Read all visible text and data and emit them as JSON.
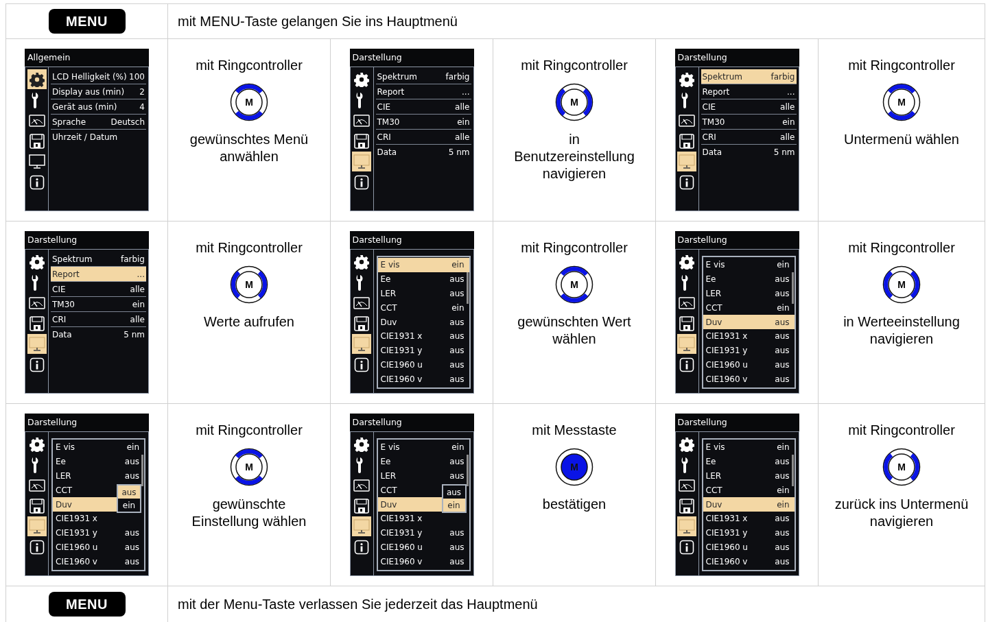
{
  "intro": {
    "key": "MENU",
    "text": "mit MENU-Taste gelangen Sie ins Hauptmenü"
  },
  "rows": [
    {
      "steps": [
        {
          "screen": {
            "title": "Allgemein",
            "icons": [
              {
                "kind": "gear",
                "selected": true
              },
              {
                "kind": "wrench",
                "selected": false
              },
              {
                "kind": "gauge",
                "selected": false
              },
              {
                "kind": "floppy",
                "selected": false
              },
              {
                "kind": "monitor",
                "selected": false
              },
              {
                "kind": "info",
                "selected": false
              }
            ],
            "items": [
              {
                "label": "LCD Helligkeit (%)",
                "value": "100",
                "selected": false
              },
              {
                "label": "Display aus (min)",
                "value": "2",
                "selected": false
              },
              {
                "label": "Gerät aus (min)",
                "value": "4",
                "selected": false
              },
              {
                "label": "Sprache",
                "value": "Deutsch",
                "selected": false
              },
              {
                "label": "Uhrzeit / Datum",
                "selected": false
              }
            ]
          },
          "control": {
            "kind": "vertical",
            "label": "M"
          },
          "heading": "mit Ringcontroller",
          "text": "gewünschtes Menü anwählen"
        },
        {
          "screen": {
            "title": "Darstellung",
            "icons": [
              {
                "kind": "gear",
                "selected": false
              },
              {
                "kind": "wrench",
                "selected": false
              },
              {
                "kind": "gauge",
                "selected": false
              },
              {
                "kind": "floppy",
                "selected": false
              },
              {
                "kind": "monitor",
                "selected": true
              },
              {
                "kind": "info",
                "selected": false
              }
            ],
            "items": [
              {
                "label": "Spektrum",
                "value": "farbig",
                "selected": false
              },
              {
                "label": "Report",
                "value": "...",
                "selected": false
              },
              {
                "label": "CIE",
                "value": "alle",
                "selected": false
              },
              {
                "label": "TM30",
                "value": "ein",
                "selected": false
              },
              {
                "label": "CRI",
                "value": "alle",
                "selected": false
              },
              {
                "label": "Data",
                "value": "5 nm",
                "selected": false
              }
            ]
          },
          "control": {
            "kind": "horizontal",
            "label": "M"
          },
          "heading": "mit Ringcontroller",
          "text": "in Benutzereinstellung navigieren"
        },
        {
          "screen": {
            "title": "Darstellung",
            "icons": [
              {
                "kind": "gear",
                "selected": false
              },
              {
                "kind": "wrench",
                "selected": false
              },
              {
                "kind": "gauge",
                "selected": false
              },
              {
                "kind": "floppy",
                "selected": false
              },
              {
                "kind": "monitor",
                "selected": true
              },
              {
                "kind": "info",
                "selected": false
              }
            ],
            "items": [
              {
                "label": "Spektrum",
                "value": "farbig",
                "selected": true
              },
              {
                "label": "Report",
                "value": "...",
                "selected": false
              },
              {
                "label": "CIE",
                "value": "alle",
                "selected": false
              },
              {
                "label": "TM30",
                "value": "ein",
                "selected": false
              },
              {
                "label": "CRI",
                "value": "alle",
                "selected": false
              },
              {
                "label": "Data",
                "value": "5 nm",
                "selected": false
              }
            ]
          },
          "control": {
            "kind": "vertical",
            "label": "M"
          },
          "heading": "mit Ringcontroller",
          "text": "Untermenü wählen"
        }
      ]
    },
    {
      "steps": [
        {
          "screen": {
            "title": "Darstellung",
            "icons": [
              {
                "kind": "gear",
                "selected": false
              },
              {
                "kind": "wrench",
                "selected": false
              },
              {
                "kind": "gauge",
                "selected": false
              },
              {
                "kind": "floppy",
                "selected": false
              },
              {
                "kind": "monitor",
                "selected": true
              },
              {
                "kind": "info",
                "selected": false
              }
            ],
            "items": [
              {
                "label": "Spektrum",
                "value": "farbig",
                "selected": false
              },
              {
                "label": "Report",
                "value": "...",
                "selected": true
              },
              {
                "label": "CIE",
                "value": "alle",
                "selected": false
              },
              {
                "label": "TM30",
                "value": "ein",
                "selected": false
              },
              {
                "label": "CRI",
                "value": "alle",
                "selected": false
              },
              {
                "label": "Data",
                "value": "5 nm",
                "selected": false
              }
            ]
          },
          "control": {
            "kind": "horizontal",
            "label": "M"
          },
          "heading": "mit Ringcontroller",
          "text": "Werte aufrufen"
        },
        {
          "screen": {
            "title": "Darstellung",
            "icons": [
              {
                "kind": "gear",
                "selected": false
              },
              {
                "kind": "wrench",
                "selected": false
              },
              {
                "kind": "gauge",
                "selected": false
              },
              {
                "kind": "floppy",
                "selected": false
              },
              {
                "kind": "monitor",
                "selected": true
              },
              {
                "kind": "info",
                "selected": false
              }
            ],
            "list": [
              {
                "label": "E vis",
                "value": "ein",
                "selected": true
              },
              {
                "label": "Ee",
                "value": "aus",
                "selected": false
              },
              {
                "label": "LER",
                "value": "aus",
                "selected": false
              },
              {
                "label": "CCT",
                "value": "ein",
                "selected": false
              },
              {
                "label": "Duv",
                "value": "aus",
                "selected": false
              },
              {
                "label": "CIE1931 x",
                "value": "aus",
                "selected": false
              },
              {
                "label": "CIE1931 y",
                "value": "aus",
                "selected": false
              },
              {
                "label": "CIE1960 u",
                "value": "aus",
                "selected": false
              },
              {
                "label": "CIE1960 v",
                "value": "aus",
                "selected": false
              }
            ]
          },
          "control": {
            "kind": "vertical",
            "label": "M"
          },
          "heading": "mit Ringcontroller",
          "text": "gewünschten Wert wählen"
        },
        {
          "screen": {
            "title": "Darstellung",
            "icons": [
              {
                "kind": "gear",
                "selected": false
              },
              {
                "kind": "wrench",
                "selected": false
              },
              {
                "kind": "gauge",
                "selected": false
              },
              {
                "kind": "floppy",
                "selected": false
              },
              {
                "kind": "monitor",
                "selected": true
              },
              {
                "kind": "info",
                "selected": false
              }
            ],
            "list": [
              {
                "label": "E vis",
                "value": "ein",
                "selected": false
              },
              {
                "label": "Ee",
                "value": "aus",
                "selected": false
              },
              {
                "label": "LER",
                "value": "aus",
                "selected": false
              },
              {
                "label": "CCT",
                "value": "ein",
                "selected": false
              },
              {
                "label": "Duv",
                "value": "aus",
                "selected": true
              },
              {
                "label": "CIE1931 x",
                "value": "aus",
                "selected": false
              },
              {
                "label": "CIE1931 y",
                "value": "aus",
                "selected": false
              },
              {
                "label": "CIE1960 u",
                "value": "aus",
                "selected": false
              },
              {
                "label": "CIE1960 v",
                "value": "aus",
                "selected": false
              }
            ]
          },
          "control": {
            "kind": "horizontal",
            "label": "M"
          },
          "heading": "mit Ringcontroller",
          "text": "in Werteeinstellung navigieren"
        }
      ]
    },
    {
      "steps": [
        {
          "screen": {
            "title": "Darstellung",
            "icons": [
              {
                "kind": "gear",
                "selected": false
              },
              {
                "kind": "wrench",
                "selected": false
              },
              {
                "kind": "gauge",
                "selected": false
              },
              {
                "kind": "floppy",
                "selected": false
              },
              {
                "kind": "monitor",
                "selected": true
              },
              {
                "kind": "info",
                "selected": false
              }
            ],
            "list": [
              {
                "label": "E vis",
                "value": "ein",
                "selected": false
              },
              {
                "label": "Ee",
                "value": "aus",
                "selected": false
              },
              {
                "label": "LER",
                "value": "aus",
                "selected": false
              },
              {
                "label": "CCT",
                "selected": false
              },
              {
                "label": "Duv",
                "selected": true,
                "dropdown": [
                  {
                    "label": "aus",
                    "selected": true
                  },
                  {
                    "label": "ein",
                    "selected": false
                  }
                ]
              },
              {
                "label": "CIE1931 x",
                "selected": false
              },
              {
                "label": "CIE1931 y",
                "value": "aus",
                "selected": false
              },
              {
                "label": "CIE1960 u",
                "value": "aus",
                "selected": false
              },
              {
                "label": "CIE1960 v",
                "value": "aus",
                "selected": false
              }
            ]
          },
          "control": {
            "kind": "vertical",
            "label": "M"
          },
          "heading": "mit Ringcontroller",
          "text": "gewünschte Einstellung wählen"
        },
        {
          "screen": {
            "title": "Darstellung",
            "icons": [
              {
                "kind": "gear",
                "selected": false
              },
              {
                "kind": "wrench",
                "selected": false
              },
              {
                "kind": "gauge",
                "selected": false
              },
              {
                "kind": "floppy",
                "selected": false
              },
              {
                "kind": "monitor",
                "selected": true
              },
              {
                "kind": "info",
                "selected": false
              }
            ],
            "list": [
              {
                "label": "E vis",
                "value": "ein",
                "selected": false
              },
              {
                "label": "Ee",
                "value": "aus",
                "selected": false
              },
              {
                "label": "LER",
                "value": "aus",
                "selected": false
              },
              {
                "label": "CCT",
                "selected": false
              },
              {
                "label": "Duv",
                "selected": true,
                "dropdown": [
                  {
                    "label": "aus",
                    "selected": false
                  },
                  {
                    "label": "ein",
                    "selected": true
                  }
                ]
              },
              {
                "label": "CIE1931 x",
                "selected": false
              },
              {
                "label": "CIE1931 y",
                "value": "aus",
                "selected": false
              },
              {
                "label": "CIE1960 u",
                "value": "aus",
                "selected": false
              },
              {
                "label": "CIE1960 v",
                "value": "aus",
                "selected": false
              }
            ]
          },
          "control": {
            "kind": "button",
            "label": "M"
          },
          "heading": "mit Messtaste",
          "text": "bestätigen"
        },
        {
          "screen": {
            "title": "Darstellung",
            "icons": [
              {
                "kind": "gear",
                "selected": false
              },
              {
                "kind": "wrench",
                "selected": false
              },
              {
                "kind": "gauge",
                "selected": false
              },
              {
                "kind": "floppy",
                "selected": false
              },
              {
                "kind": "monitor",
                "selected": true
              },
              {
                "kind": "info",
                "selected": false
              }
            ],
            "list": [
              {
                "label": "E vis",
                "value": "ein",
                "selected": false
              },
              {
                "label": "Ee",
                "value": "aus",
                "selected": false
              },
              {
                "label": "LER",
                "value": "aus",
                "selected": false
              },
              {
                "label": "CCT",
                "value": "ein",
                "selected": false
              },
              {
                "label": "Duv",
                "value": "ein",
                "selected": true
              },
              {
                "label": "CIE1931 x",
                "value": "aus",
                "selected": false
              },
              {
                "label": "CIE1931 y",
                "value": "aus",
                "selected": false
              },
              {
                "label": "CIE1960 u",
                "value": "aus",
                "selected": false
              },
              {
                "label": "CIE1960 v",
                "value": "aus",
                "selected": false
              }
            ]
          },
          "control": {
            "kind": "horizontal",
            "label": "M"
          },
          "heading": "mit Ringcontroller",
          "text": "zurück ins Untermenü navigieren"
        }
      ]
    }
  ],
  "outro": {
    "key": "MENU",
    "text": "mit der Menu-Taste verlassen Sie jederzeit das Hauptmenü"
  }
}
